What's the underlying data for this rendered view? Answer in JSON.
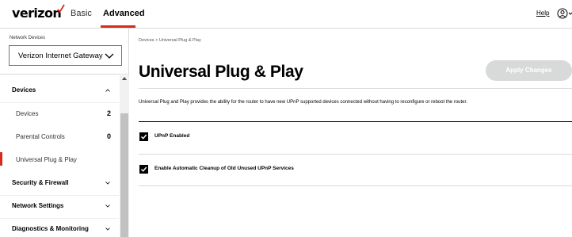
{
  "header": {
    "logo": "verizon",
    "tabs": [
      {
        "label": "Basic"
      },
      {
        "label": "Advanced"
      }
    ],
    "help": "Help"
  },
  "sidebar": {
    "network_devices_label": "Network Devices",
    "selected_device": "Verizon Internet Gateway",
    "menu": [
      {
        "label": "Devices",
        "type": "header"
      },
      {
        "label": "Devices",
        "count": "2"
      },
      {
        "label": "Parental Controls",
        "count": "0"
      },
      {
        "label": "Universal Plug & Play"
      },
      {
        "label": "Security & Firewall",
        "type": "header"
      },
      {
        "label": "Network Settings",
        "type": "header"
      },
      {
        "label": "Diagnostics & Monitoring",
        "type": "header"
      }
    ]
  },
  "main": {
    "breadcrumb": "Devices  >  Universal Plug & Play",
    "title": "Universal Plug & Play",
    "apply_button": "Apply Changes",
    "description": "Universal Plug and Play provides the ability for the router to have new UPnP supported devices connected without having to reconfigure or reboot the router.",
    "options": [
      {
        "label": "UPnP Enabled",
        "checked": true
      },
      {
        "label": "Enable Automatic Cleanup of Old Unused UPnP Services",
        "checked": true
      }
    ]
  },
  "colors": {
    "accent": "#d52b1e",
    "disabled_button": "#d8dada"
  }
}
